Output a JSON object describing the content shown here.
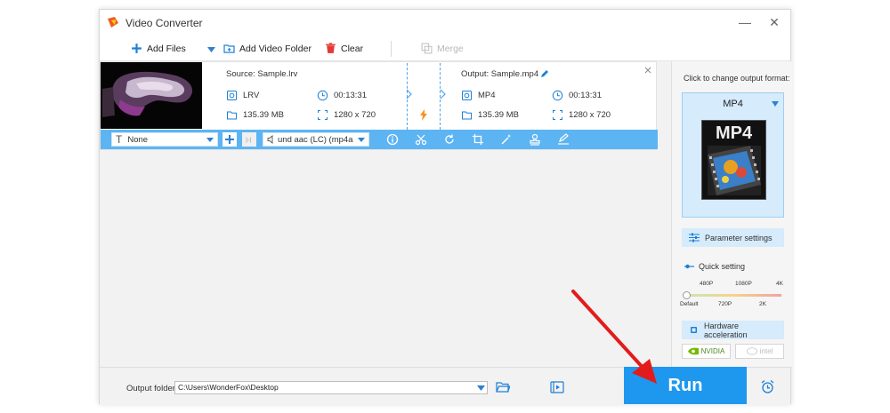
{
  "window": {
    "title": "Video Converter",
    "minimize": "—",
    "close": "✕"
  },
  "toolbar": {
    "add_files": "Add Files",
    "add_video_folder": "Add Video Folder",
    "clear": "Clear",
    "merge": "Merge"
  },
  "file": {
    "source_label": "Source: Sample.lrv",
    "source_format": "LRV",
    "source_duration": "00:13:31",
    "source_size": "135.39 MB",
    "source_resolution": "1280 x 720",
    "output_label": "Output: Sample.mp4",
    "output_format": "MP4",
    "output_duration": "00:13:31",
    "output_size": "135.39 MB",
    "output_resolution": "1280 x 720"
  },
  "edit_bar": {
    "subtitle_value": "None",
    "audio_value": "und aac (LC) (mp4a"
  },
  "right_panel": {
    "change_format_label": "Click to change output format:",
    "format_name": "MP4",
    "format_badge": "MP4",
    "parameter_settings": "Parameter settings",
    "quick_setting": "Quick setting",
    "scale_top": [
      "480P",
      "1080P",
      "4K"
    ],
    "scale_bottom": [
      "Default",
      "720P",
      "2K"
    ],
    "hardware_acceleration": "Hardware acceleration",
    "nvidia": "NVIDIA",
    "intel": "intel"
  },
  "bottom": {
    "output_folder_label": "Output folder:",
    "output_folder_path": "C:\\Users\\WonderFox\\Desktop",
    "run": "Run"
  },
  "colors": {
    "accent": "#1e98ee",
    "edit_bar": "#5db4f3",
    "arrow": "#e21c1c"
  }
}
